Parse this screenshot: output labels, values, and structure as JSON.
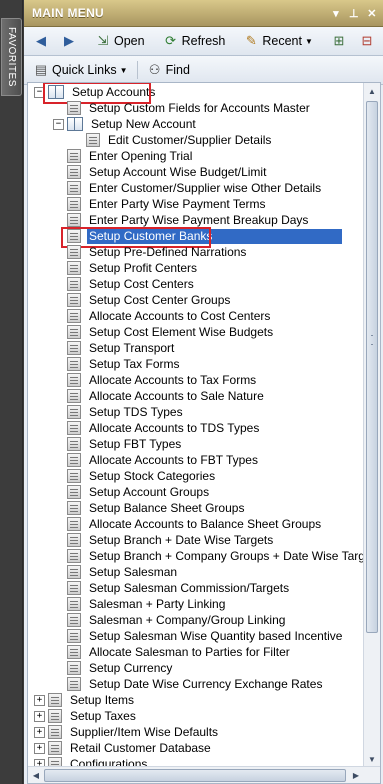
{
  "favorites": {
    "label": "FAVORITES"
  },
  "panel": {
    "title": "MAIN MENU"
  },
  "toolbar": {
    "open_label": "Open",
    "refresh_label": "Refresh",
    "recent_label": "Recent",
    "quick_links_label": "Quick Links",
    "find_label": "Find"
  },
  "tree": {
    "setup_accounts": "Setup Accounts",
    "items": [
      "Setup Custom Fields for Accounts Master",
      "Setup New Account",
      "Edit Customer/Supplier Details",
      "Enter Opening Trial",
      "Setup Account Wise Budget/Limit",
      "Enter Customer/Supplier wise Other Details",
      "Enter Party Wise Payment Terms",
      "Enter Party Wise Payment Breakup Days",
      "Setup Customer Banks",
      "Setup Pre-Defined Narrations",
      "Setup Profit Centers",
      "Setup Cost Centers",
      "Setup Cost Center Groups",
      "Allocate Accounts to Cost Centers",
      "Setup Cost Element Wise Budgets",
      "Setup Transport",
      "Setup Tax Forms",
      "Allocate Accounts to Tax Forms",
      "Allocate Accounts to Sale Nature",
      "Setup TDS Types",
      "Allocate Accounts to TDS Types",
      "Setup FBT Types",
      "Allocate Accounts to FBT Types",
      "Setup Stock Categories",
      "Setup Account Groups",
      "Setup Balance Sheet Groups",
      "Allocate Accounts to Balance Sheet Groups",
      "Setup Branch + Date Wise Targets",
      "Setup Branch + Company Groups + Date Wise Targets",
      "Setup Salesman",
      "Setup Salesman Commission/Targets",
      "Salesman + Party Linking",
      "Salesman + Company/Group Linking",
      "Setup Salesman Wise Quantity based Incentive",
      "Allocate Salesman to Parties for Filter",
      "Setup Currency",
      "Setup Date Wise Currency Exchange Rates"
    ],
    "top_level": [
      "Setup Items",
      "Setup Taxes",
      "Supplier/Item Wise Defaults",
      "Retail Customer Database",
      "Configurations"
    ],
    "selected": "Setup Customer Banks"
  },
  "colors": {
    "selection": "#316ac5",
    "highlight_box": "#d8232a",
    "title_bar": "#b8a46e"
  }
}
